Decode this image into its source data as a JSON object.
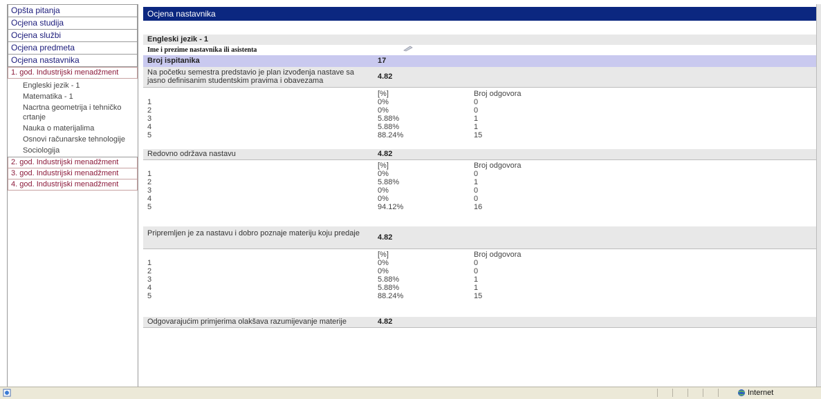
{
  "sidebar": {
    "top": [
      "Opšta pitanja",
      "Ocjena studija",
      "Ocjena službi",
      "Ocjena predmeta",
      "Ocjena nastavnika"
    ],
    "year1": "1. god. Industrijski menadžment",
    "courses": [
      "Engleski jezik - 1",
      "Matematika - 1",
      "Nacrtna geometrija i tehničko crtanje",
      "Nauka o materijalima",
      "Osnovi računarske tehnologije",
      "Sociologija"
    ],
    "years": [
      "2. god. Industrijski menadžment",
      "3. god. Industrijski menadžment",
      "4. god. Industrijski menadžment"
    ]
  },
  "main": {
    "title": "Ocjena nastavnika",
    "course": "Engleski jezik - 1",
    "teacher_label": "Ime i prezime nastavnika ili asistenta",
    "respondents_label": "Broj ispitanika",
    "respondents": "17",
    "pct_header": "[%]",
    "count_header": "Broj odgovora",
    "questions": [
      {
        "text": "Na početku semestra predstavio je plan izvođenja nastave sa jasno definisanim studentskim pravima i obavezama",
        "score": "4.82",
        "rows": [
          [
            "1",
            "0%",
            "0"
          ],
          [
            "2",
            "0%",
            "0"
          ],
          [
            "3",
            "5.88%",
            "1"
          ],
          [
            "4",
            "5.88%",
            "1"
          ],
          [
            "5",
            "88.24%",
            "15"
          ]
        ]
      },
      {
        "text": "Redovno održava nastavu",
        "score": "4.82",
        "rows": [
          [
            "1",
            "0%",
            "0"
          ],
          [
            "2",
            "5.88%",
            "1"
          ],
          [
            "3",
            "0%",
            "0"
          ],
          [
            "4",
            "0%",
            "0"
          ],
          [
            "5",
            "94.12%",
            "16"
          ]
        ]
      },
      {
        "text": "Pripremljen je za nastavu i dobro poznaje materiju koju predaje",
        "score": "4.82",
        "rows": [
          [
            "1",
            "0%",
            "0"
          ],
          [
            "2",
            "0%",
            "0"
          ],
          [
            "3",
            "5.88%",
            "1"
          ],
          [
            "4",
            "5.88%",
            "1"
          ],
          [
            "5",
            "88.24%",
            "15"
          ]
        ]
      },
      {
        "text": "Odgovarajućim primjerima olakšava razumijevanje materije",
        "score": "4.82",
        "rows": []
      }
    ]
  },
  "statusbar": {
    "zone": "Internet"
  }
}
